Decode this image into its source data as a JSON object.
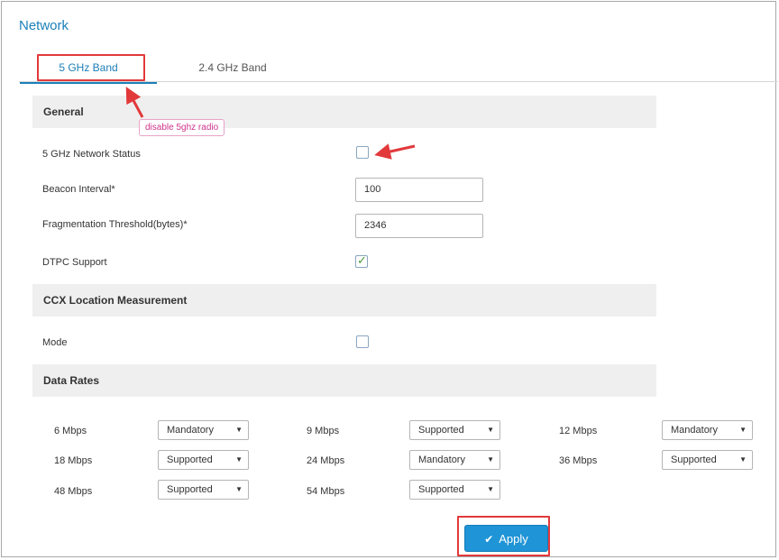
{
  "page": {
    "title": "Network"
  },
  "tabs": [
    {
      "label": "5 GHz Band",
      "active": true
    },
    {
      "label": "2.4 GHz Band",
      "active": false
    }
  ],
  "general": {
    "header": "General",
    "network_status_label": "5 GHz Network Status",
    "network_status_checked": false,
    "beacon_interval_label": "Beacon Interval*",
    "beacon_interval_value": "100",
    "fragmentation_label": "Fragmentation Threshold(bytes)*",
    "fragmentation_value": "2346",
    "dtpc_label": "DTPC Support",
    "dtpc_checked": true
  },
  "ccx": {
    "header": "CCX Location Measurement",
    "mode_label": "Mode",
    "mode_checked": false
  },
  "data_rates": {
    "header": "Data Rates",
    "rates": [
      {
        "label": "6 Mbps",
        "value": "Mandatory"
      },
      {
        "label": "9 Mbps",
        "value": "Supported"
      },
      {
        "label": "12 Mbps",
        "value": "Mandatory"
      },
      {
        "label": "18 Mbps",
        "value": "Supported"
      },
      {
        "label": "24 Mbps",
        "value": "Mandatory"
      },
      {
        "label": "36 Mbps",
        "value": "Supported"
      },
      {
        "label": "48 Mbps",
        "value": "Supported"
      },
      {
        "label": "54 Mbps",
        "value": "Supported"
      }
    ]
  },
  "actions": {
    "apply_label": "Apply",
    "apply_icon": "check-icon"
  },
  "annotation": {
    "text": "disable 5ghz radio"
  },
  "colors": {
    "accent": "#1b7fb8",
    "apply_button": "#1f94d6",
    "highlight": "#e2393b",
    "annotation_text": "#d0338b"
  },
  "icons": {
    "dropdown": "caret-down-icon",
    "checkmark": "check-icon"
  }
}
